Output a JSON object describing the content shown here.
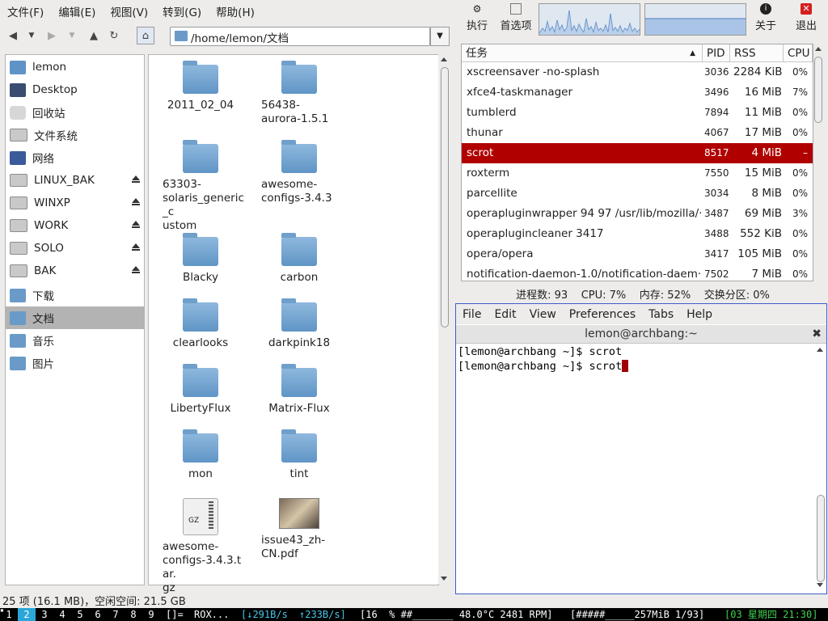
{
  "thunar": {
    "menu": [
      "文件(F)",
      "编辑(E)",
      "视图(V)",
      "转到(G)",
      "帮助(H)"
    ],
    "location": "/home/lemon/文档",
    "sidebar": [
      {
        "label": "lemon",
        "icon": "home-icon"
      },
      {
        "label": "Desktop",
        "icon": "desktop-icon"
      },
      {
        "label": "回收站",
        "icon": "trash-icon"
      },
      {
        "label": "文件系统",
        "icon": "drive-icon"
      },
      {
        "label": "网络",
        "icon": "network-icon"
      },
      {
        "label": "LINUX_BAK",
        "icon": "drive-icon",
        "eject": true
      },
      {
        "label": "WINXP",
        "icon": "drive-icon",
        "eject": true
      },
      {
        "label": "WORK",
        "icon": "drive-icon",
        "eject": true
      },
      {
        "label": "SOLO",
        "icon": "drive-icon",
        "eject": true
      },
      {
        "label": "BAK",
        "icon": "drive-icon",
        "eject": true
      },
      {
        "label": "下载",
        "icon": "folder-icon"
      },
      {
        "label": "文档",
        "icon": "folder-icon",
        "selected": true
      },
      {
        "label": "音乐",
        "icon": "folder-icon"
      },
      {
        "label": "图片",
        "icon": "folder-icon"
      }
    ],
    "files": [
      {
        "name": "2011_02_04",
        "type": "folder"
      },
      {
        "name": "56438-\naurora-1.5.1",
        "type": "folder"
      },
      {
        "name": "63303-\nsolaris_generic_c\nustom",
        "type": "folder"
      },
      {
        "name": "awesome-\nconfigs-3.4.3",
        "type": "folder"
      },
      {
        "name": "Blacky",
        "type": "folder"
      },
      {
        "name": "carbon",
        "type": "folder"
      },
      {
        "name": "clearlooks",
        "type": "folder"
      },
      {
        "name": "darkpink18",
        "type": "folder"
      },
      {
        "name": "LibertyFlux",
        "type": "folder"
      },
      {
        "name": "Matrix-Flux",
        "type": "folder"
      },
      {
        "name": "mon",
        "type": "folder"
      },
      {
        "name": "tint",
        "type": "folder"
      },
      {
        "name": "awesome-\nconfigs-3.4.3.tar.\ngz",
        "type": "archive",
        "badge": "GZ"
      },
      {
        "name": "issue43_zh-\nCN.pdf",
        "type": "pdf"
      }
    ],
    "status": "25 项 (16.1 MB)，空闲空间: 21.5 GB"
  },
  "taskmanager": {
    "buttons": {
      "run": "执行",
      "prefs": "首选项",
      "about": "关于",
      "quit": "退出"
    },
    "columns": [
      "任务",
      "PID",
      "RSS",
      "CPU"
    ],
    "rows": [
      {
        "name": "xscreensaver -no-splash",
        "pid": "3036",
        "rss": "2284 KiB",
        "cpu": "0%"
      },
      {
        "name": "xfce4-taskmanager",
        "pid": "3496",
        "rss": "16 MiB",
        "cpu": "7%"
      },
      {
        "name": "tumblerd",
        "pid": "7894",
        "rss": "11 MiB",
        "cpu": "0%"
      },
      {
        "name": "thunar",
        "pid": "4067",
        "rss": "17 MiB",
        "cpu": "0%"
      },
      {
        "name": "scrot",
        "pid": "8517",
        "rss": "4 MiB",
        "cpu": "–",
        "selected": true
      },
      {
        "name": "roxterm",
        "pid": "7550",
        "rss": "15 MiB",
        "cpu": "0%"
      },
      {
        "name": "parcellite",
        "pid": "3034",
        "rss": "8 MiB",
        "cpu": "0%"
      },
      {
        "name": "operapluginwrapper 94 97 /usr/lib/mozilla/···",
        "pid": "3487",
        "rss": "69 MiB",
        "cpu": "3%"
      },
      {
        "name": "operaplugincleaner 3417",
        "pid": "3488",
        "rss": "552 KiB",
        "cpu": "0%"
      },
      {
        "name": "opera/opera",
        "pid": "3417",
        "rss": "105 MiB",
        "cpu": "0%"
      },
      {
        "name": "notification-daemon-1.0/notification-daem···",
        "pid": "7502",
        "rss": "7 MiB",
        "cpu": "0%"
      }
    ],
    "status": "进程数: 93    CPU: 7%    内存: 52%    交换分区: 0%"
  },
  "terminal": {
    "menu": [
      "File",
      "Edit",
      "View",
      "Preferences",
      "Tabs",
      "Help"
    ],
    "title": "lemon@archbang:~",
    "lines": [
      "[lemon@archbang ~]$ scrot",
      "[lemon@archbang ~]$ scrot"
    ]
  },
  "bar": {
    "tags": [
      "1",
      "2",
      "3",
      "4",
      "5",
      "6",
      "7",
      "8",
      "9"
    ],
    "layout": "[]=",
    "client": "ROX...",
    "net_down": "[↓291B/s",
    "net_up": "↑233B/s]",
    "stats": "[16  % ##_______ 48.0°C 2481 RPM]",
    "mem": "[#####_____257MiB 1/93]",
    "clock": "[03 星期四 21:30]"
  }
}
